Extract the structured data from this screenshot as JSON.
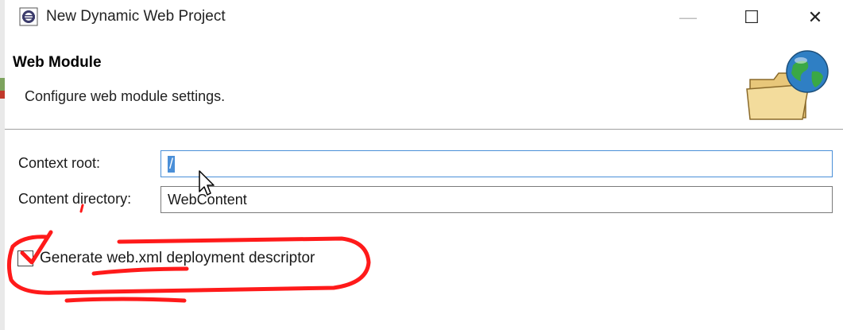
{
  "window": {
    "title": "New Dynamic Web Project",
    "controls": {
      "minimize": "—",
      "maximize": "☐",
      "close": "✕"
    }
  },
  "banner": {
    "title": "Web Module",
    "description": "Configure web module settings.",
    "icon": "folder-globe-icon"
  },
  "form": {
    "context_root": {
      "label": "Context root:",
      "value": "/"
    },
    "content_directory": {
      "label": "Content directory:",
      "value": "WebContent"
    },
    "generate_descriptor": {
      "label": "Generate web.xml deployment descriptor",
      "checked": false
    }
  },
  "colors": {
    "selection": "#4a8fd8",
    "annotation": "#ff1a1a"
  }
}
